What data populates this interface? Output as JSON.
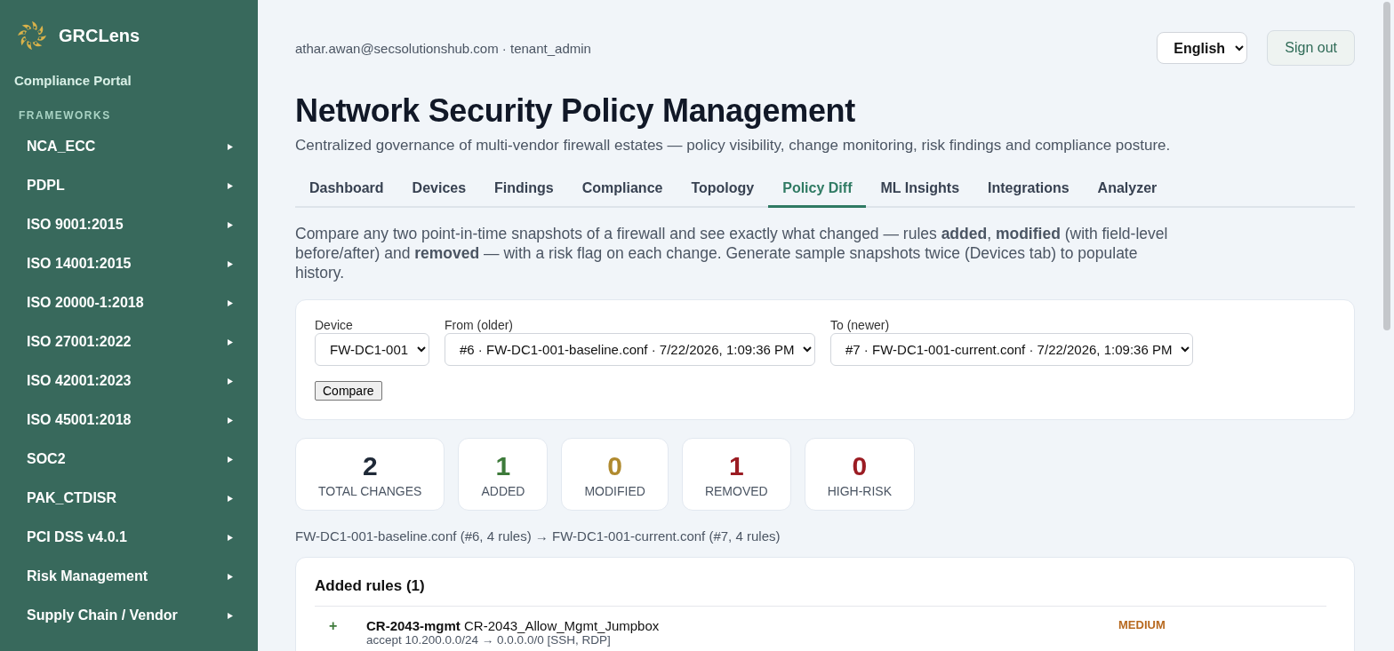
{
  "sidebar": {
    "brand": "GRCLens",
    "subtitle": "Compliance Portal",
    "section": "FRAMEWORKS",
    "items": [
      {
        "label": "NCA_ECC",
        "expanded": false
      },
      {
        "label": "PDPL",
        "expanded": false
      },
      {
        "label": "ISO 9001:2015",
        "expanded": false
      },
      {
        "label": "ISO 14001:2015",
        "expanded": false
      },
      {
        "label": "ISO 20000-1:2018",
        "expanded": false
      },
      {
        "label": "ISO 27001:2022",
        "expanded": false
      },
      {
        "label": "ISO 42001:2023",
        "expanded": false
      },
      {
        "label": "ISO 45001:2018",
        "expanded": false
      },
      {
        "label": "SOC2",
        "expanded": false
      },
      {
        "label": "PAK_CTDISR",
        "expanded": false
      },
      {
        "label": "PCI DSS v4.0.1",
        "expanded": false
      },
      {
        "label": "Risk Management",
        "expanded": false
      },
      {
        "label": "Supply Chain / Vendor",
        "expanded": false
      }
    ]
  },
  "header": {
    "user": "athar.awan@secsolutionshub.com · tenant_admin",
    "language": "English",
    "sign_out": "Sign out"
  },
  "page": {
    "title": "Network Security Policy Management",
    "subtitle": "Centralized governance of multi-vendor firewall estates — policy visibility, change monitoring, risk findings and compliance posture."
  },
  "tabs": [
    {
      "label": "Dashboard",
      "selected": false
    },
    {
      "label": "Devices",
      "selected": false
    },
    {
      "label": "Findings",
      "selected": false
    },
    {
      "label": "Compliance",
      "selected": false
    },
    {
      "label": "Topology",
      "selected": false
    },
    {
      "label": "Policy Diff",
      "selected": true
    },
    {
      "label": "ML Insights",
      "selected": false
    },
    {
      "label": "Integrations",
      "selected": false
    },
    {
      "label": "Analyzer",
      "selected": false
    }
  ],
  "intro": "Compare any two point-in-time snapshots of a firewall and see exactly what changed — rules **added**, **modified** (with field-level before/after) and **removed** — with a risk flag on each change. Generate sample snapshots twice (Devices tab) to populate history.",
  "form": {
    "fields": [
      {
        "label": "Device",
        "value": "FW-DC1-001"
      },
      {
        "label": "From (older)",
        "value": "#6 · FW-DC1-001-baseline.conf · 7/22/2026, 1:09:36 PM"
      },
      {
        "label": "To (newer)",
        "value": "#7 · FW-DC1-001-current.conf · 7/22/2026, 1:09:36 PM"
      }
    ],
    "button": "Compare"
  },
  "stats": [
    {
      "value": "2",
      "label": "TOTAL CHANGES",
      "color": "#1f2937"
    },
    {
      "value": "1",
      "label": "ADDED",
      "color": "#3d7a3a"
    },
    {
      "value": "0",
      "label": "MODIFIED",
      "color": "#b08a2e"
    },
    {
      "value": "1",
      "label": "REMOVED",
      "color": "#9b1c23"
    },
    {
      "value": "0",
      "label": "HIGH-RISK",
      "color": "#9b1c23"
    }
  ],
  "summary": "FW-DC1-001-baseline.conf (#6, 4 rules) → FW-DC1-001-current.conf (#7, 4 rules)",
  "added": {
    "title": "Added rules (1)",
    "rows": [
      {
        "sign": "+",
        "id": "CR-2043-mgmt",
        "name": "CR-2043_Allow_Mgmt_Jumpbox",
        "detail": "accept 10.200.0.0/24 → 0.0.0.0/0 [SSH, RDP]",
        "risk": "MEDIUM",
        "color": "#b7691f"
      }
    ]
  }
}
